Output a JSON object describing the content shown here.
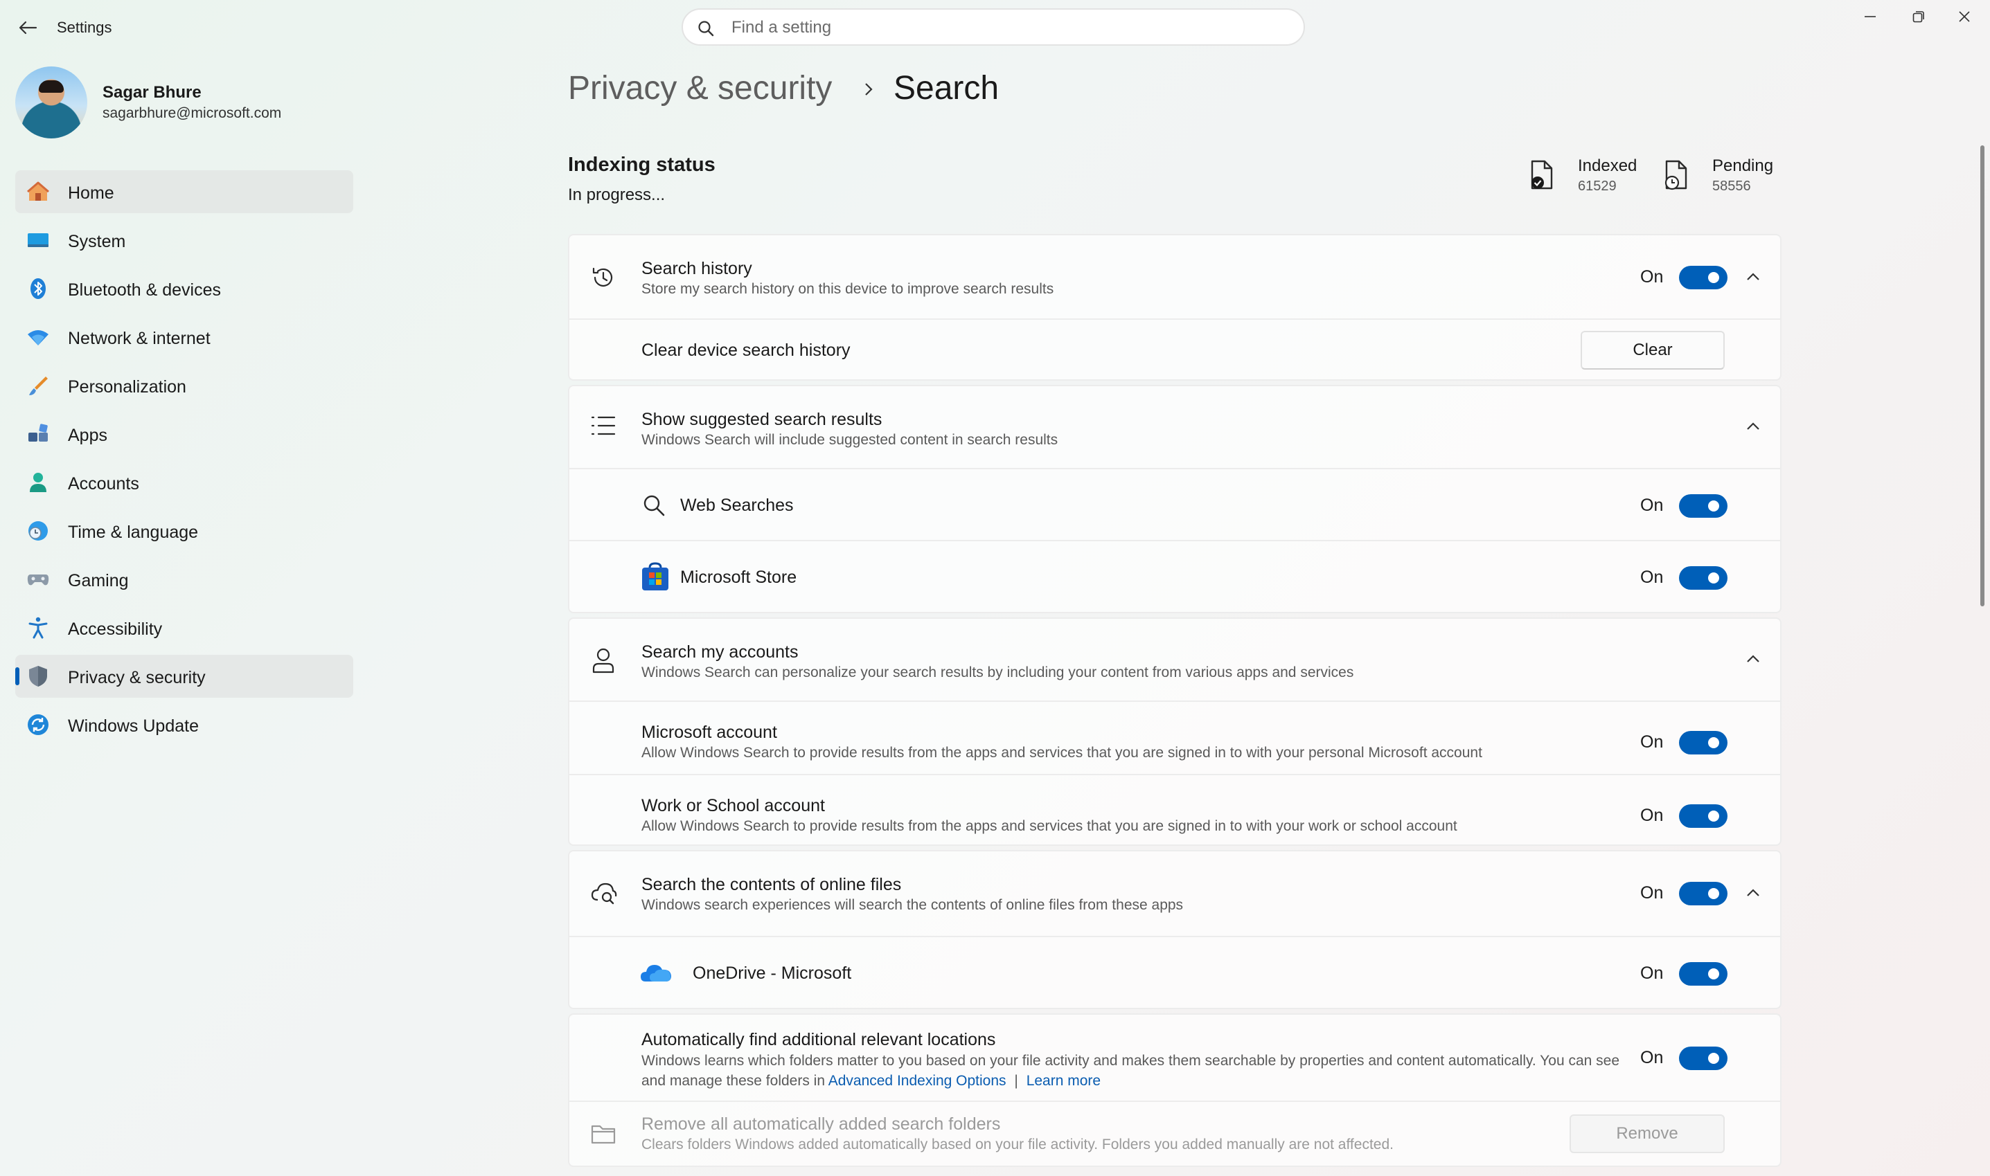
{
  "window": {
    "app_title": "Settings"
  },
  "search": {
    "placeholder": "Find a setting"
  },
  "profile": {
    "name": "Sagar Bhure",
    "email": "sagarbhure@microsoft.com"
  },
  "sidebar": {
    "items": [
      {
        "label": "Home",
        "icon": "home-icon"
      },
      {
        "label": "System",
        "icon": "system-icon"
      },
      {
        "label": "Bluetooth & devices",
        "icon": "bluetooth-icon"
      },
      {
        "label": "Network & internet",
        "icon": "wifi-icon"
      },
      {
        "label": "Personalization",
        "icon": "brush-icon"
      },
      {
        "label": "Apps",
        "icon": "apps-icon"
      },
      {
        "label": "Accounts",
        "icon": "accounts-icon"
      },
      {
        "label": "Time & language",
        "icon": "clock-globe-icon"
      },
      {
        "label": "Gaming",
        "icon": "gamepad-icon"
      },
      {
        "label": "Accessibility",
        "icon": "accessibility-icon"
      },
      {
        "label": "Privacy & security",
        "icon": "shield-icon"
      },
      {
        "label": "Windows Update",
        "icon": "update-icon"
      }
    ],
    "active_item": "Privacy & security"
  },
  "breadcrumb": {
    "parent": "Privacy & security",
    "current": "Search"
  },
  "indexing": {
    "title": "Indexing status",
    "status": "In progress...",
    "indexed_label": "Indexed",
    "indexed_value": "61529",
    "pending_label": "Pending",
    "pending_value": "58556"
  },
  "on_label": "On",
  "search_history": {
    "title": "Search history",
    "desc": "Store my search history on this device to improve search results",
    "clear_row_title": "Clear device search history",
    "clear_button": "Clear"
  },
  "suggested": {
    "title": "Show suggested search results",
    "desc": "Windows Search will include suggested content in search results",
    "web_searches": "Web Searches",
    "microsoft_store": "Microsoft Store"
  },
  "accounts": {
    "title": "Search my accounts",
    "desc": "Windows Search can personalize your search results by including your content from various apps and services",
    "ms_title": "Microsoft account",
    "ms_desc": "Allow Windows Search to provide results from the apps and services that you are signed in to with your personal Microsoft account",
    "work_title": "Work or School account",
    "work_desc": "Allow Windows Search to provide results from the apps and services that you are signed in to with your work or school account"
  },
  "online_files": {
    "title": "Search the contents of online files",
    "desc": "Windows search experiences will search the contents of online files from these apps",
    "onedrive": "OneDrive - Microsoft"
  },
  "auto_find": {
    "title": "Automatically find additional relevant locations",
    "desc": "Windows learns which folders matter to you based on your file activity and makes them searchable by properties and content automatically. You can see and manage these folders in",
    "link_advanced": "Advanced Indexing Options",
    "separator": "|",
    "link_learn": "Learn more"
  },
  "remove_folders": {
    "title": "Remove all automatically added search folders",
    "desc": "Clears folders Windows added automatically based on your file activity. Folders you added manually are not affected.",
    "button": "Remove"
  },
  "colors": {
    "accent": "#005fb8",
    "link": "#0a5cb0"
  }
}
